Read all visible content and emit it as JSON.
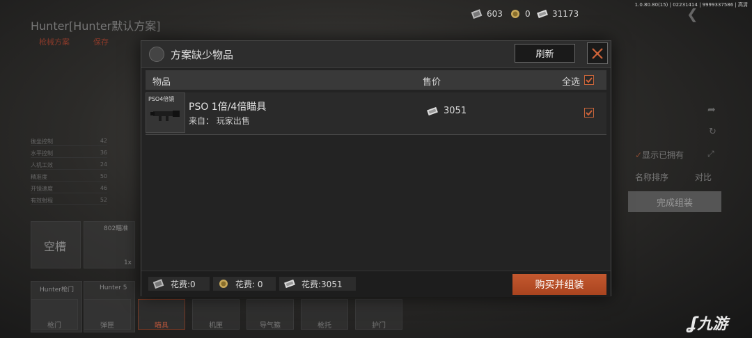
{
  "watermark": "1.0.80.80(15) | 02231414 | 9999337586 | 高清",
  "background": {
    "title": "Hunter[Hunter默认方案]",
    "tabs": [
      "枪械方案",
      "保存"
    ],
    "stats": [
      {
        "label": "後坐控制",
        "value": "42"
      },
      {
        "label": "水平控制",
        "value": "36"
      },
      {
        "label": "人机工效",
        "value": "24"
      },
      {
        "label": "精准度",
        "value": "50"
      },
      {
        "label": "开镜速度",
        "value": "46"
      },
      {
        "label": "有效射程",
        "value": "52"
      }
    ],
    "empty_slot": "空槽",
    "slot2_label": "802瞄准",
    "slot2_count": "1x",
    "slot3_label": "Hunter枪门",
    "slot4_label": "Hunter 5",
    "bottom_tabs": [
      "枪门",
      "弹匣",
      "瞄具",
      "机匣",
      "导气箍",
      "枪托",
      "护门"
    ],
    "show_owned": "显示已拥有",
    "sort_label": "名称排序",
    "compare_label": "对比",
    "complete_label": "完成组装"
  },
  "currency": {
    "c1": "603",
    "c2": "0",
    "c3": "31173"
  },
  "dialog": {
    "title": "方案缺少物品",
    "refresh": "刷新",
    "col_item": "物品",
    "col_price": "售价",
    "select_all": "全选",
    "items": [
      {
        "thumb_label": "PSO4倍镜",
        "name": "PSO 1倍/4倍瞄具",
        "source": "来自：  玩家出售",
        "price": "3051",
        "checked": true
      }
    ],
    "costs": [
      "花费:0",
      "花费: 0",
      "花费:3051"
    ],
    "buy_button": "购买并组装"
  },
  "logo": "九游",
  "colors": {
    "accent": "#c4582f",
    "checkbox_border": "#c8653a"
  }
}
